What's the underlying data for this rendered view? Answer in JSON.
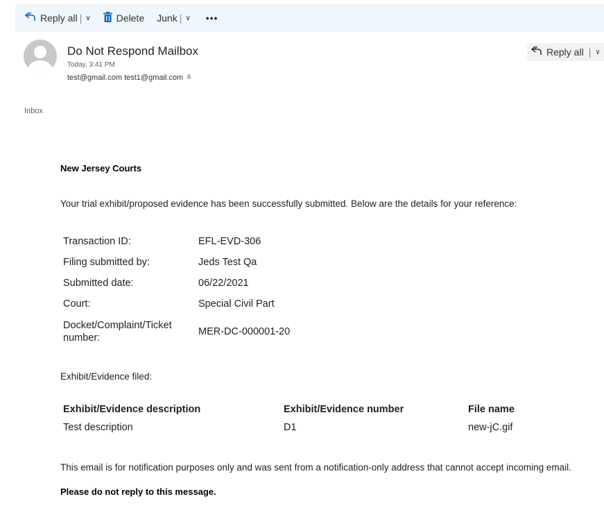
{
  "toolbar": {
    "reply_all_label": "Reply all",
    "delete_label": "Delete",
    "junk_label": "Junk",
    "more_label": "•••",
    "divider": "|",
    "chevron": "∨"
  },
  "message": {
    "sender": "Do Not Respond Mailbox",
    "date": "Today, 3:41 PM",
    "recipients": "test@gmail.com test1@gmail.com",
    "expand_glyph": "≚",
    "reply_all_label": "Reply all",
    "folder": "Inbox"
  },
  "body": {
    "org": "New Jersey Courts",
    "intro": "Your trial exhibit/proposed evidence has been successfully submitted. Below are the details for your reference:",
    "details": [
      {
        "label": "Transaction ID:",
        "value": "EFL-EVD-306"
      },
      {
        "label": "Filing submitted by:",
        "value": "Jeds Test Qa"
      },
      {
        "label": "Submitted date:",
        "value": "06/22/2021"
      },
      {
        "label": "Court:",
        "value": "Special Civil Part"
      },
      {
        "label": "Docket/Complaint/Ticket number:",
        "value": "MER-DC-000001-20"
      }
    ],
    "filed_label": "Exhibit/Evidence filed:",
    "exhibit_table": {
      "headers": [
        "Exhibit/Evidence description",
        "Exhibit/Evidence number",
        "File name"
      ],
      "rows": [
        [
          "Test description",
          "D1",
          "new-jC.gif"
        ]
      ]
    },
    "notice": "This email is for notification purposes only and was sent from a notification-only address that cannot accept incoming email.",
    "notice_bold": "Please do not reply to this message."
  },
  "colors": {
    "accent": "#0f6cbd",
    "toolbar_bg": "#eff6fc",
    "avatar": "#c8c8c8"
  },
  "icons": {
    "reply_all": "reply-all-icon",
    "delete": "trash-icon",
    "more": "more-horizontal-icon",
    "avatar": "person-avatar-icon",
    "expand": "double-chevron-down-icon"
  }
}
